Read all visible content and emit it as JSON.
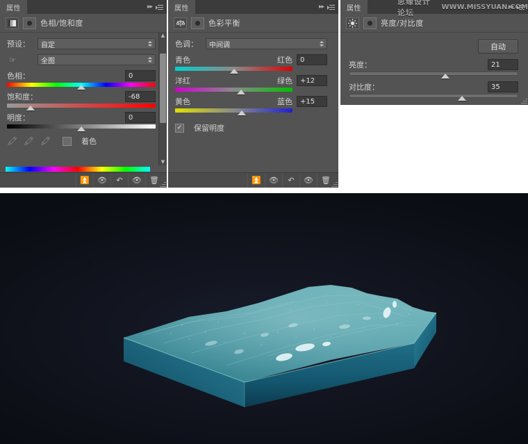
{
  "watermark": {
    "cn": "思缘设计论坛",
    "en": "WWW.MISSYUAN.COM"
  },
  "panels": {
    "hue_saturation": {
      "tab_label": "属性",
      "title": "色相/饱和度",
      "preset_label": "预设：",
      "preset_value": "自定",
      "channel_value": "全图",
      "hue_label": "色相：",
      "hue_value": "0",
      "saturation_label": "饱和度：",
      "saturation_value": "-68",
      "lightness_label": "明度：",
      "lightness_value": "0",
      "colorize_label": "着色",
      "colorize_checked": false,
      "hue_thumb_pct": 50,
      "saturation_thumb_pct": 16,
      "lightness_thumb_pct": 50
    },
    "color_balance": {
      "tab_label": "属性",
      "title": "色彩平衡",
      "tone_label": "色调：",
      "tone_value": "中间调",
      "cyan_label": "青色",
      "red_label": "红色",
      "cyan_red_value": "0",
      "cyan_red_thumb_pct": 50,
      "magenta_label": "洋红",
      "green_label": "绿色",
      "magenta_green_value": "+12",
      "magenta_green_thumb_pct": 56,
      "yellow_label": "黄色",
      "blue_label": "蓝色",
      "yellow_blue_value": "+15",
      "yellow_blue_thumb_pct": 57,
      "preserve_luminosity_label": "保留明度",
      "preserve_luminosity_checked": true
    },
    "brightness_contrast": {
      "tab_label": "属性",
      "title": "亮度/对比度",
      "auto_label": "自动",
      "brightness_label": "亮度：",
      "brightness_value": "21",
      "brightness_thumb_pct": 57,
      "contrast_label": "对比度：",
      "contrast_value": "35",
      "contrast_thumb_pct": 67
    }
  },
  "footer_icons": {
    "clip_to_layer": "clip-to-layer-icon",
    "preview_toggle": "preview-eye-icon",
    "reset": "reset-arrow-icon",
    "visibility": "visibility-eye-icon",
    "delete": "trash-icon"
  },
  "artwork": {
    "name": "teal-terrain-slab-render",
    "background_color": "#12151f",
    "slab_top_color": "#3f8b98",
    "slab_side_color": "#0f5c78"
  }
}
